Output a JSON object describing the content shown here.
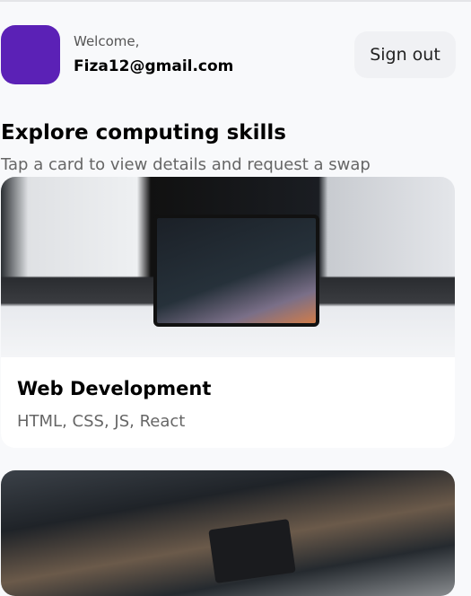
{
  "header": {
    "welcome": "Welcome,",
    "email": "Fiza12@gmail.com",
    "signout_label": "Sign out",
    "avatar_color": "#5b21b6"
  },
  "main": {
    "title": "Explore computing skills",
    "subtitle": "Tap a card to view details and request a swap",
    "cards": [
      {
        "title": "Web Development",
        "subtitle": "HTML, CSS, JS, React",
        "image": "laptop-with-code-photo"
      },
      {
        "image": "circuit-board-photo"
      }
    ]
  }
}
